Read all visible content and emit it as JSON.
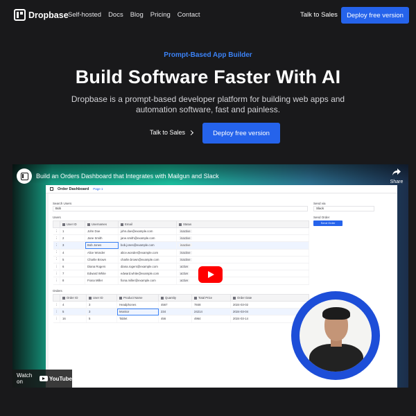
{
  "nav": {
    "logo": "Dropbase",
    "links": [
      "Self-hosted",
      "Docs",
      "Blog",
      "Pricing",
      "Contact"
    ],
    "talk": "Talk to Sales",
    "deploy": "Deploy free version"
  },
  "hero": {
    "eyebrow": "Prompt-Based App Builder",
    "headline": "Build Software Faster With AI",
    "sub": "Dropbase is a prompt-based developer platform for building web apps and automation software, fast and painless.",
    "talk": "Talk to Sales",
    "deploy": "Deploy free version"
  },
  "video": {
    "title": "Build an Orders Dashboard that Integrates with Mailgun and Slack",
    "share": "Share",
    "watch_on": "Watch on",
    "youtube": "YouTube",
    "app": {
      "title": "Order Dashboard",
      "page": "Page 1",
      "search_label": "Search Users",
      "search_value": "Bob",
      "send_via_label": "Send via",
      "send_via_value": "Slack",
      "send_order_label": "Send Order",
      "send_button": "Send Order",
      "users_label": "Users",
      "orders_label": "Orders",
      "users_headers": [
        "User ID",
        "Usernames",
        "Email",
        "Status"
      ],
      "users_rows": [
        [
          "1",
          "John Doe",
          "john.doe@example.com",
          "inactive"
        ],
        [
          "2",
          "Jane Smith",
          "jane.smith@example.com",
          "inactive"
        ],
        [
          "3",
          "Bob Jones",
          "bob.jones@example.com",
          "inactive"
        ],
        [
          "4",
          "Alice Wonder",
          "alice.wonder@example.com",
          "inactive"
        ],
        [
          "5",
          "Charlie Brown",
          "charlie.brown@example.com",
          "inactive"
        ],
        [
          "6",
          "Diana Rogers",
          "diana.rogers@example.com",
          "active"
        ],
        [
          "7",
          "Edward White",
          "edward.white@example.com",
          "active"
        ],
        [
          "8",
          "Fiona Miller",
          "fiona.miller@example.com",
          "active"
        ]
      ],
      "orders_headers": [
        "Order ID",
        "User ID",
        "Product Name",
        "Quantity",
        "Total Price",
        "Order Date"
      ],
      "orders_rows": [
        [
          "4",
          "3",
          "Headphones",
          "4567",
          "7848",
          "2024-03-02"
        ],
        [
          "5",
          "3",
          "Monitor",
          "234",
          "24214",
          "2024-03-04"
        ],
        [
          "16",
          "5",
          "Tablet",
          "456",
          "4964",
          "2024-03-14"
        ]
      ]
    }
  },
  "colors": {
    "accent": "#2563eb",
    "background": "#19191b",
    "eyebrow": "#3b82f6"
  }
}
